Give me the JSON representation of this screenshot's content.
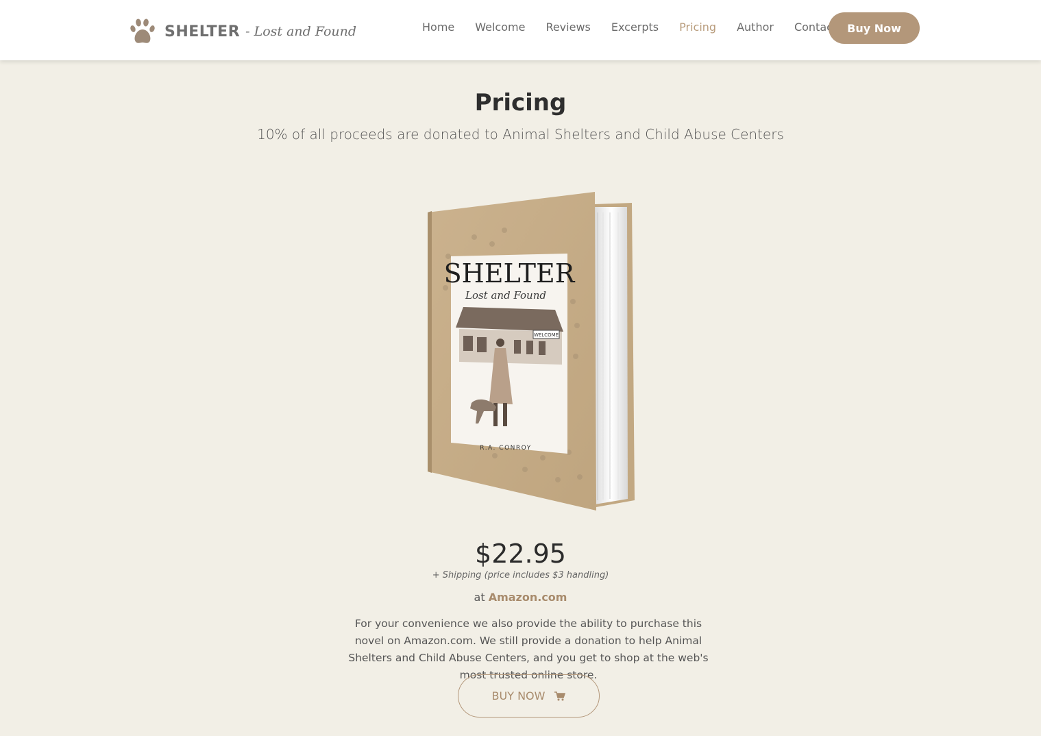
{
  "header": {
    "brand_name": "SHELTER",
    "brand_sub": "- Lost and Found",
    "nav": [
      {
        "label": "Home"
      },
      {
        "label": "Welcome"
      },
      {
        "label": "Reviews"
      },
      {
        "label": "Excerpts"
      },
      {
        "label": "Pricing"
      },
      {
        "label": "Author"
      },
      {
        "label": "Contact"
      }
    ],
    "active_nav": "Pricing",
    "buy_label": "Buy Now"
  },
  "main": {
    "title": "Pricing",
    "subtitle": "10% of all proceeds are donated to Animal Shelters and Child Abuse Centers",
    "book": {
      "title": "SHELTER",
      "subtitle": "Lost and Found",
      "sign": "WELCOME",
      "author": "R.A. CONROY"
    },
    "price": "$22.95",
    "shipping": "+ Shipping (price includes $3 handling)",
    "at_prefix": "at",
    "store": "Amazon.com",
    "description": "For your convenience we also provide the ability to purchase this novel on Amazon.com. We still provide a donation to help Animal Shelters and Child Abuse Centers, and you get to shop at the web's most trusted online store.",
    "buy_label": "BUY NOW"
  },
  "colors": {
    "accent": "#b3977a",
    "background": "#f2efe6",
    "header_bg": "#ffffff",
    "book_cover": "#c7ad88"
  },
  "icons": [
    "paw-icon",
    "cart-icon"
  ]
}
